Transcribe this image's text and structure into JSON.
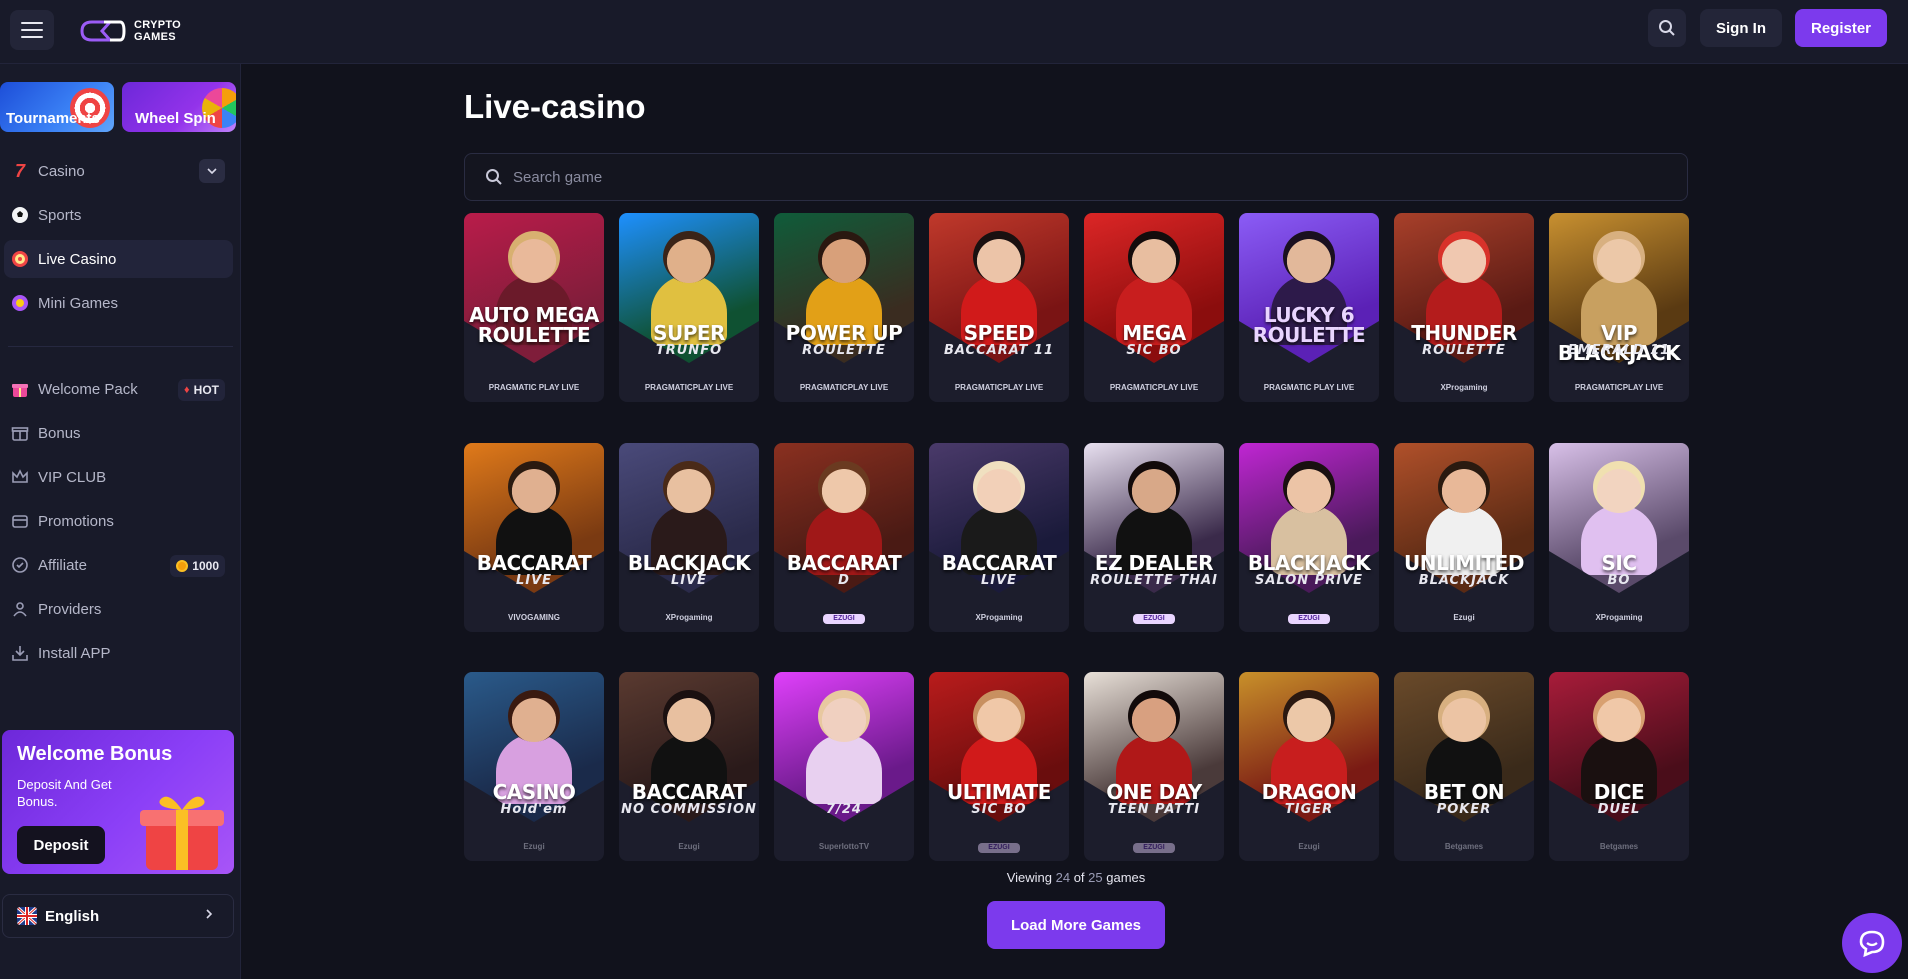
{
  "header": {
    "logo_line1": "CRYPTO",
    "logo_line2": "GAMES",
    "signin_label": "Sign In",
    "register_label": "Register"
  },
  "sidebar": {
    "promo": [
      {
        "label": "Tournaments"
      },
      {
        "label": "Wheel Spin"
      }
    ],
    "nav": [
      {
        "label": "Casino"
      },
      {
        "label": "Sports"
      },
      {
        "label": "Live Casino"
      },
      {
        "label": "Mini Games"
      }
    ],
    "nav2": [
      {
        "label": "Welcome Pack",
        "badge": "HOT"
      },
      {
        "label": "Bonus"
      },
      {
        "label": "VIP CLUB"
      },
      {
        "label": "Promotions"
      },
      {
        "label": "Affiliate",
        "badge": "1000"
      },
      {
        "label": "Providers"
      },
      {
        "label": "Install APP"
      }
    ],
    "welcome": {
      "title": "Welcome Bonus",
      "subtitle": "Deposit And Get Bonus.",
      "button": "Deposit"
    },
    "language": "English"
  },
  "main": {
    "title": "Live-casino",
    "search_placeholder": "Search game",
    "games": [
      {
        "title": "AUTO MEGA",
        "title2": "ROULETTE",
        "sub": "",
        "provider": "PRAGMATIC PLAY LIVE",
        "bg": "#7f1d3a",
        "bg2": "#b91c4a",
        "skin": "#e9b99a",
        "outfit": "#6b1a2a",
        "hair": "#d8b070"
      },
      {
        "title": "SUPER",
        "title2": "",
        "sub": "TRUNFO",
        "provider": "PRAGMATICPLAY LIVE",
        "bg": "#0f5132",
        "bg2": "#1e90ff",
        "skin": "#e0b08a",
        "outfit": "#e0c040",
        "hair": "#3a2418"
      },
      {
        "title": "POWER UP",
        "title2": "",
        "sub": "ROULETTE",
        "provider": "PRAGMATICPLAY LIVE",
        "bg": "#3a2c20",
        "bg2": "#0f5c3a",
        "skin": "#d8a07a",
        "outfit": "#e2a017",
        "hair": "#2a1810"
      },
      {
        "title": "SPEED",
        "title2": "",
        "sub": "BACCARAT 11",
        "provider": "PRAGMATICPLAY LIVE",
        "bg": "#7a1414",
        "bg2": "#c0392b",
        "skin": "#ecc4a8",
        "outfit": "#d11a1a",
        "hair": "#1a1010"
      },
      {
        "title": "MEGA",
        "title2": "",
        "sub": "SIC BO",
        "provider": "PRAGMATICPLAY LIVE",
        "bg": "#8b0d0d",
        "bg2": "#dc2626",
        "skin": "#e8bea0",
        "outfit": "#c81e1e",
        "hair": "#140c0c"
      },
      {
        "title": "LUCKY 6",
        "title2": "ROULETTE",
        "sub": "",
        "provider": "PRAGMATIC PLAY LIVE",
        "bg": "#5b21b6",
        "bg2": "#8b5cf6",
        "skin": "#e2b89a",
        "outfit": "#2d1a4a",
        "hair": "#1a1020"
      },
      {
        "title": "THUNDER",
        "title2": "",
        "sub": "ROULETTE",
        "provider": "XProgaming",
        "bg": "#5a1a14",
        "bg2": "#a8402a",
        "skin": "#f0c8b0",
        "outfit": "#b41c1c",
        "hair": "#d8322a"
      },
      {
        "title": "VIP BLACKJACK",
        "title2": "",
        "sub": "EMERALD 11",
        "provider": "PRAGMATICPLAY LIVE",
        "bg": "#5a3a12",
        "bg2": "#c89030",
        "skin": "#ecc8a8",
        "outfit": "#c8a060",
        "hair": "#d8b080"
      },
      {
        "title": "BACCARAT",
        "title2": "",
        "sub": "LIVE",
        "provider": "VIVOGAMING",
        "bg": "#7a3a12",
        "bg2": "#e07a1a",
        "skin": "#e0b090",
        "outfit": "#111111",
        "hair": "#2a1a10"
      },
      {
        "title": "BLACKJACK",
        "title2": "",
        "sub": "LIVE",
        "provider": "XProgaming",
        "bg": "#2a2a4a",
        "bg2": "#4a4a7a",
        "skin": "#e8c0a0",
        "outfit": "#2a1a1a",
        "hair": "#4a2a18"
      },
      {
        "title": "BACCARAT",
        "title2": "",
        "sub": "D",
        "provider": "EZUGI",
        "bg": "#4a1a14",
        "bg2": "#8a3020",
        "skin": "#eec8aa",
        "outfit": "#a01818",
        "hair": "#6a3a20"
      },
      {
        "title": "BACCARAT",
        "title2": "",
        "sub": "LIVE",
        "provider": "XProgaming",
        "bg": "#1a1a3a",
        "bg2": "#4a3a6a",
        "skin": "#f2d0b8",
        "outfit": "#1a1a1a",
        "hair": "#f0e0c0"
      },
      {
        "title": "EZ DEALER",
        "title2": "",
        "sub": "ROULETTE THAI",
        "provider": "EZUGI",
        "bg": "#3a2a4a",
        "bg2": "#e8e0f0",
        "skin": "#d8a888",
        "outfit": "#111111",
        "hair": "#120a0a"
      },
      {
        "title": "BLACKJACK",
        "title2": "",
        "sub": "SALON PRIVE",
        "provider": "EZUGI",
        "bg": "#4a1a5a",
        "bg2": "#c026d3",
        "skin": "#ecc4a6",
        "outfit": "#d8c0a0",
        "hair": "#1a1010"
      },
      {
        "title": "UNLIMITED",
        "title2": "",
        "sub": "BLACKJACK",
        "provider": "Ezugi",
        "bg": "#5a2a14",
        "bg2": "#b0502a",
        "skin": "#e8b898",
        "outfit": "#f0f0f0",
        "hair": "#2a1a10"
      },
      {
        "title": "SIC",
        "title2": "",
        "sub": "BO",
        "provider": "XProgaming",
        "bg": "#5a4a6a",
        "bg2": "#d8c0e8",
        "skin": "#f2d4c0",
        "outfit": "#e0c0f0",
        "hair": "#f0e0b0"
      },
      {
        "title": "CASINO",
        "title2": "",
        "sub": "Hold'em",
        "provider": "Ezugi",
        "bg": "#1a2a4a",
        "bg2": "#2a5a8a",
        "skin": "#e0b090",
        "outfit": "#d8a0e0",
        "hair": "#3a1a10"
      },
      {
        "title": "BACCARAT",
        "title2": "",
        "sub": "NO COMMISSION",
        "provider": "Ezugi",
        "bg": "#2a1a1a",
        "bg2": "#5a3a30",
        "skin": "#e8c0a0",
        "outfit": "#111111",
        "hair": "#1a1010"
      },
      {
        "title": "",
        "title2": "",
        "sub": "7/24",
        "provider": "SuperlottoTV",
        "bg": "#6a1a8a",
        "bg2": "#e040fb",
        "skin": "#f0d0c0",
        "outfit": "#e8d0f0",
        "hair": "#e8c8a0"
      },
      {
        "title": "ULTIMATE",
        "title2": "",
        "sub": "SIC BO",
        "provider": "EZUGI",
        "bg": "#6a0d0d",
        "bg2": "#b91c1c",
        "skin": "#f0c8a8",
        "outfit": "#d11a1a",
        "hair": "#c89060"
      },
      {
        "title": "ONE DAY",
        "title2": "",
        "sub": "TEEN PATTI",
        "provider": "EZUGI",
        "bg": "#4a3a3a",
        "bg2": "#e8e0d8",
        "skin": "#d8a080",
        "outfit": "#b01818",
        "hair": "#120a0a"
      },
      {
        "title": "DRAGON",
        "title2": "",
        "sub": "TIGER",
        "provider": "Ezugi",
        "bg": "#7a1a14",
        "bg2": "#c8902a",
        "skin": "#ecc8a8",
        "outfit": "#c81e1e",
        "hair": "#2a1810"
      },
      {
        "title": "BET ON",
        "title2": "",
        "sub": "POKER",
        "provider": "Betgames",
        "bg": "#3a2a1a",
        "bg2": "#6a4a2a",
        "skin": "#ecc4a4",
        "outfit": "#111111",
        "hair": "#d8b080"
      },
      {
        "title": "DICE",
        "title2": "",
        "sub": "DUEL",
        "provider": "Betgames",
        "bg": "#4a0d1a",
        "bg2": "#a81c3a",
        "skin": "#f0c8a8",
        "outfit": "#1a1010",
        "hair": "#d8a070"
      }
    ],
    "viewing_prefix": "Viewing",
    "viewing_shown": "24",
    "viewing_of": "of",
    "viewing_total": "25",
    "viewing_suffix": "games",
    "load_more": "Load More Games"
  },
  "colors": {
    "accent": "#7c3aed",
    "background": "#11121c",
    "panel": "#181a29"
  }
}
